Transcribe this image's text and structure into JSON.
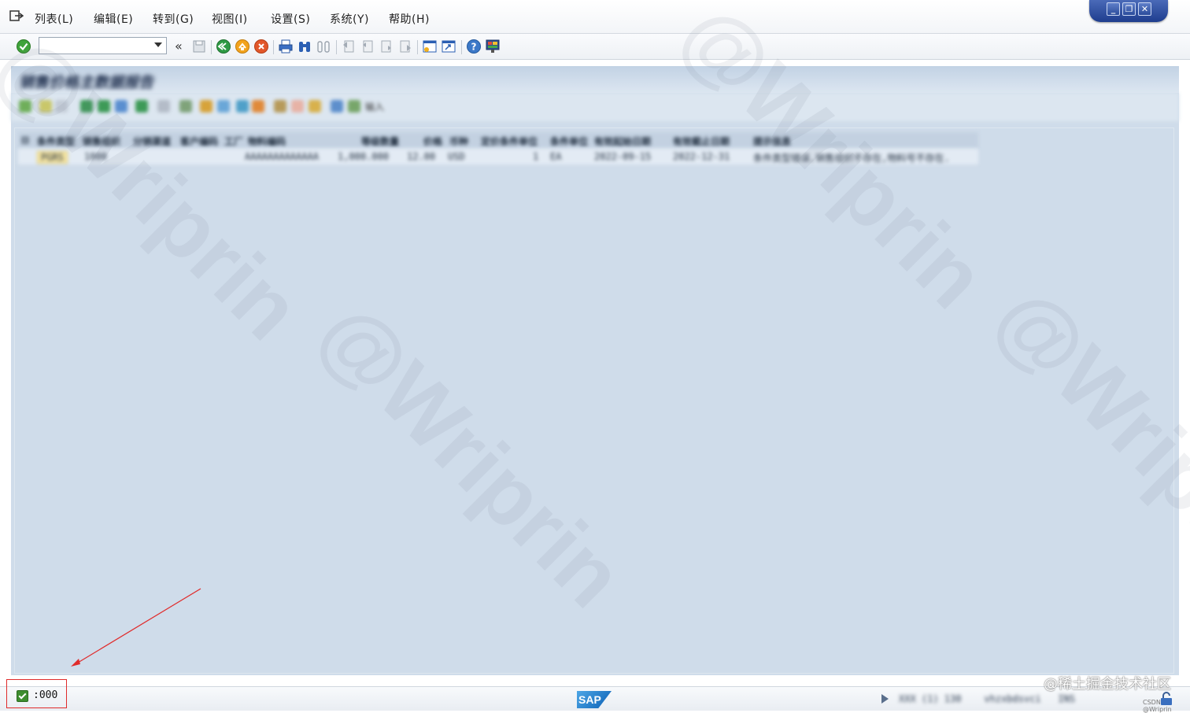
{
  "menu": {
    "items": [
      "列表(L)",
      "编辑(E)",
      "转到(G)",
      "视图(I)",
      "设置(S)",
      "系统(Y)",
      "帮助(H)"
    ]
  },
  "window": {
    "minimize": "_",
    "restore": "❐",
    "close": "✕"
  },
  "toolbar": {
    "command_value": "",
    "chevron": "«",
    "icons": [
      "enter-check",
      "save",
      "back",
      "exit",
      "cancel",
      "print",
      "find",
      "find-next",
      "first-page",
      "previous-page",
      "next-page",
      "last-page",
      "create-session",
      "create-shortcut",
      "help",
      "customize-layout"
    ]
  },
  "page": {
    "title": "销售价格主数据报告"
  },
  "alv_toolbar": {
    "import_label": "输入"
  },
  "grid": {
    "columns": [
      "条件类型",
      "销售组织",
      "分销渠道",
      "客户编码",
      "工厂",
      "物料编码",
      "等级数量",
      "价格",
      "币种",
      "定价条件单位",
      "条件单位",
      "有效起始日期",
      "有效截止日期",
      "提示信息"
    ],
    "rows": [
      {
        "condition_type": "PGRS",
        "sales_org": "1000",
        "material": "AAAAAAAAAAAAA",
        "scale_qty": "1,000.000",
        "price": "12.00",
        "currency": "USD",
        "pricing_unit": "1",
        "unit": "EA",
        "valid_from": "2022-09-15",
        "valid_to": "2022-12-31",
        "message": "条件类型错误,销售组织不存在,物料号不存在."
      }
    ]
  },
  "status": {
    "message": ":000",
    "system_info": "XXX (1) 130",
    "server": "vhzxbdsvci",
    "mode": "INS"
  },
  "watermarks": {
    "main": "@Wriprin",
    "juejin": "@稀土掘金技术社区",
    "csdn": "CSDN @Wriprin"
  }
}
